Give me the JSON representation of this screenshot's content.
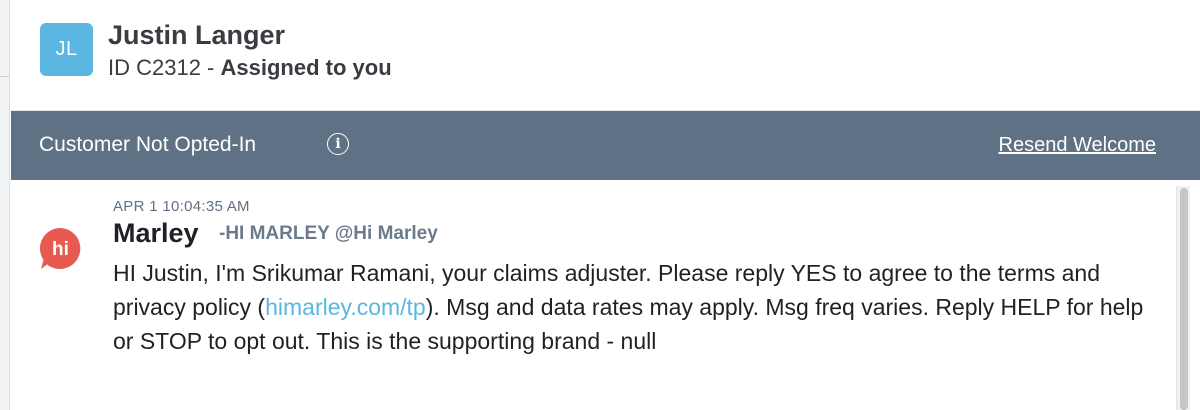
{
  "contact": {
    "initials": "JL",
    "name": "Justin Langer",
    "id_prefix": "ID C2312 -",
    "assignment": "Assigned to you"
  },
  "banner": {
    "status": "Customer Not Opted-In",
    "info_glyph": "i",
    "action_label": "Resend Welcome"
  },
  "message": {
    "timestamp": "APR 1 10:04:35 AM",
    "avatar_text": "hi",
    "sender": "Marley",
    "handle": "-HI MARLEY @Hi Marley",
    "text_before_link": "HI Justin, I'm Srikumar Ramani, your claims adjuster. Please reply YES to agree to the terms and privacy policy (",
    "link_text": "himarley.com/tp",
    "text_after_link": "). Msg and data rates may apply. Msg freq varies. Reply HELP for help or STOP to opt out. This is the supporting brand - null"
  },
  "colors": {
    "avatar": "#5bb7e2",
    "banner": "#5f7184",
    "hi_bubble": "#e85a4f",
    "link": "#5bb7e2"
  }
}
